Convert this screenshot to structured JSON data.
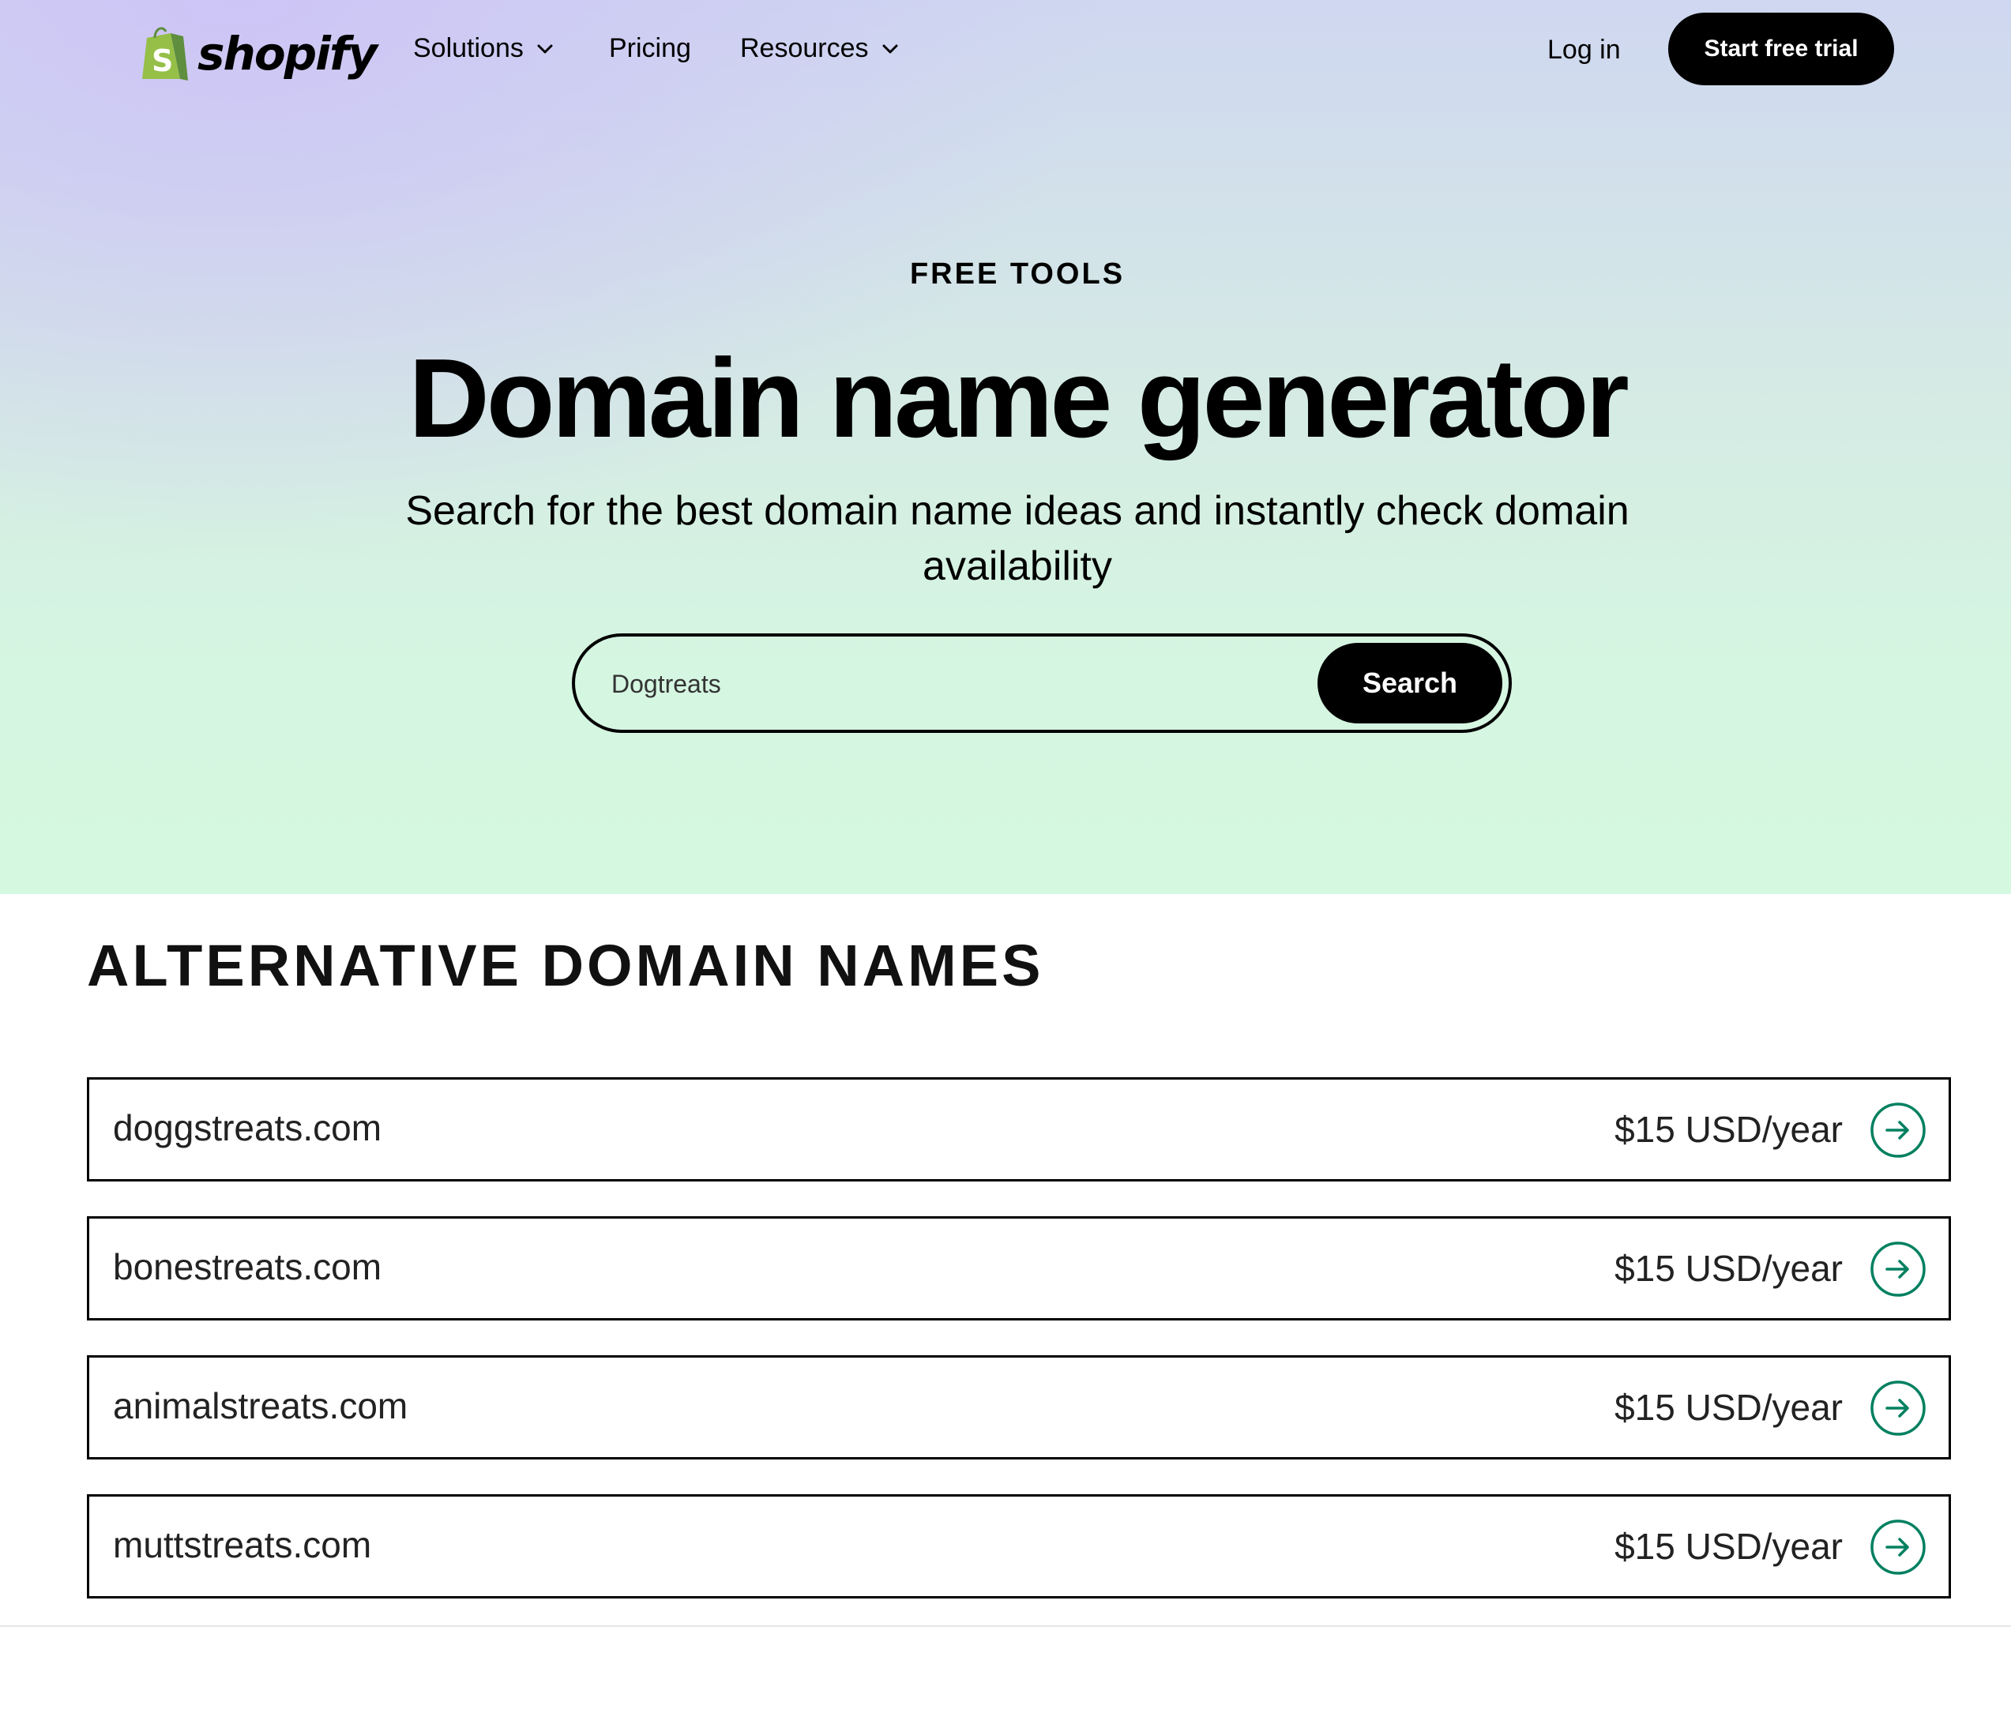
{
  "nav": {
    "logo_text": "shopify",
    "items": [
      {
        "label": "Solutions",
        "has_dropdown": true
      },
      {
        "label": "Pricing",
        "has_dropdown": false
      },
      {
        "label": "Resources",
        "has_dropdown": true
      }
    ],
    "login_label": "Log in",
    "trial_label": "Start free trial"
  },
  "hero": {
    "eyebrow": "FREE TOOLS",
    "title": "Domain name generator",
    "subtitle": "Search for the best domain name ideas and instantly check domain availability"
  },
  "search": {
    "value": "Dogtreats",
    "button_label": "Search"
  },
  "alternatives": {
    "heading": "ALTERNATIVE DOMAIN NAMES",
    "items": [
      {
        "domain": "doggstreats.com",
        "price": "$15 USD/year"
      },
      {
        "domain": "bonestreats.com",
        "price": "$15 USD/year"
      },
      {
        "domain": "animalstreats.com",
        "price": "$15 USD/year"
      },
      {
        "domain": "muttstreats.com",
        "price": "$15 USD/year"
      }
    ]
  },
  "colors": {
    "accent_green": "#008060",
    "logo_green": "#95bf47",
    "logo_dark_green": "#5e8e3e",
    "button_black": "#000000"
  },
  "icons": {
    "logo": "shopify-bag-icon",
    "dropdown": "chevron-down-icon",
    "row_action": "arrow-right-circle-icon"
  }
}
